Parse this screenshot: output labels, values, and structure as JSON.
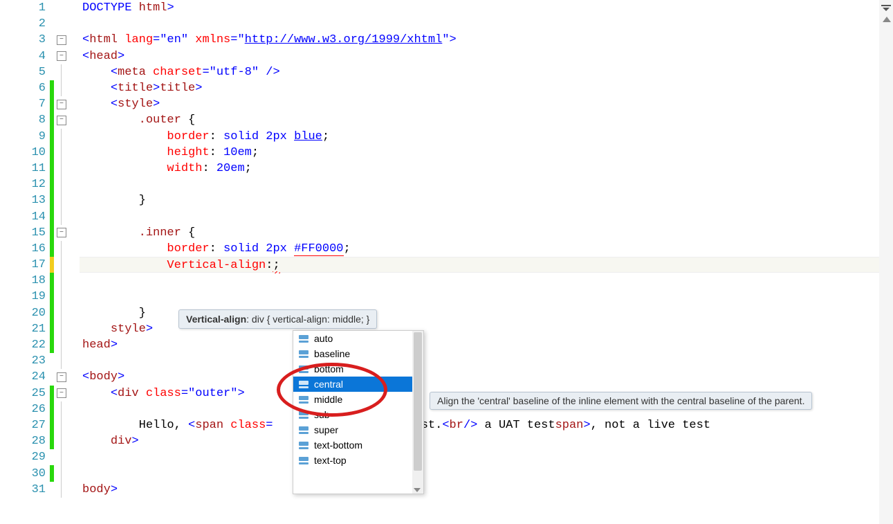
{
  "lines": [
    {
      "num": "1",
      "change": "",
      "fold": "none"
    },
    {
      "num": "2",
      "change": "",
      "fold": "none"
    },
    {
      "num": "3",
      "change": "",
      "fold": "minus"
    },
    {
      "num": "4",
      "change": "",
      "fold": "minus"
    },
    {
      "num": "5",
      "change": "",
      "fold": "line"
    },
    {
      "num": "6",
      "change": "green",
      "fold": "line"
    },
    {
      "num": "7",
      "change": "green",
      "fold": "minus"
    },
    {
      "num": "8",
      "change": "green",
      "fold": "minus"
    },
    {
      "num": "9",
      "change": "green",
      "fold": "line"
    },
    {
      "num": "10",
      "change": "green",
      "fold": "line"
    },
    {
      "num": "11",
      "change": "green",
      "fold": "line"
    },
    {
      "num": "12",
      "change": "green",
      "fold": "line"
    },
    {
      "num": "13",
      "change": "green",
      "fold": "line"
    },
    {
      "num": "14",
      "change": "green",
      "fold": "line"
    },
    {
      "num": "15",
      "change": "green",
      "fold": "minus"
    },
    {
      "num": "16",
      "change": "green",
      "fold": "line"
    },
    {
      "num": "17",
      "change": "yellow",
      "fold": "line"
    },
    {
      "num": "18",
      "change": "green",
      "fold": "line"
    },
    {
      "num": "19",
      "change": "green",
      "fold": "line"
    },
    {
      "num": "20",
      "change": "green",
      "fold": "line"
    },
    {
      "num": "21",
      "change": "green",
      "fold": "line"
    },
    {
      "num": "22",
      "change": "green",
      "fold": "line"
    },
    {
      "num": "23",
      "change": "",
      "fold": "line"
    },
    {
      "num": "24",
      "change": "",
      "fold": "minus"
    },
    {
      "num": "25",
      "change": "green",
      "fold": "minus"
    },
    {
      "num": "26",
      "change": "green",
      "fold": "line"
    },
    {
      "num": "27",
      "change": "green",
      "fold": "line"
    },
    {
      "num": "28",
      "change": "green",
      "fold": "line"
    },
    {
      "num": "29",
      "change": "",
      "fold": "line"
    },
    {
      "num": "30",
      "change": "green",
      "fold": "line"
    },
    {
      "num": "31",
      "change": "",
      "fold": "line"
    }
  ],
  "code": {
    "l1": {
      "open": "<!",
      "doctype": "DOCTYPE ",
      "html": "html",
      "close": ">"
    },
    "l3": {
      "open": "<",
      "tag": "html",
      "sp": " ",
      "attr1": "lang",
      "eq": "=",
      "val1": "\"en\"",
      "attr2": "xmlns",
      "val2url": "http://www.w3.org/1999/xhtml",
      "close": ">"
    },
    "l4": {
      "open": "<",
      "tag": "head",
      "close": ">"
    },
    "l5": {
      "open": "<",
      "tag": "meta",
      "sp": " ",
      "attr": "charset",
      "eq": "=",
      "val": "\"utf-8\"",
      "end": " />"
    },
    "l6": {
      "open": "<",
      "tag": "title",
      "close": ">",
      "open2": "</",
      "tag2": "title",
      "close2": ">"
    },
    "l7": {
      "open": "<",
      "tag": "style",
      "close": ">"
    },
    "l8": {
      "sel": ".outer ",
      "brace": "{"
    },
    "l9": {
      "prop": "border",
      "colon": ": ",
      "val": "solid 2px ",
      "blue": "blue",
      "semi": ";"
    },
    "l10": {
      "prop": "height",
      "colon": ": ",
      "val": "10em",
      "semi": ";"
    },
    "l11": {
      "prop": "width",
      "colon": ": ",
      "val": "20em",
      "semi": ";"
    },
    "l13": {
      "brace": "}"
    },
    "l15": {
      "sel": ".inner ",
      "brace": "{"
    },
    "l16": {
      "prop": "border",
      "colon": ": ",
      "val": "solid 2px ",
      "color": "#FF0000",
      "semi": ";"
    },
    "l17": {
      "prop": "Vertical-align",
      "colon": ":",
      "semi": ";"
    },
    "l20": {
      "brace": "}"
    },
    "l21": {
      "open": "</",
      "tag": "style",
      "close": ">"
    },
    "l22": {
      "open": "</",
      "tag": "head",
      "close": ">"
    },
    "l24": {
      "open": "<",
      "tag": "body",
      "close": ">"
    },
    "l25": {
      "open": "<",
      "tag": "div",
      "sp": " ",
      "attr": "class",
      "eq": "=",
      "val": "\"outer\"",
      "close": ">"
    },
    "l27": {
      "text1": "Hello, ",
      "open": "<",
      "tag": "span",
      "sp": " ",
      "attr": "class",
      "eq": "=",
      "text2": " test.",
      "open2": "<",
      "tag2": "br",
      "close2": "/>",
      "text3": " a UAT test",
      "open3": "</",
      "tag3": "span",
      "close3": ">",
      "text4": ", not a live test"
    },
    "l28": {
      "open": "</",
      "tag": "div",
      "close": ">"
    },
    "l31": {
      "open": "</",
      "tag": "body",
      "close": ">"
    }
  },
  "hint": {
    "label": "Vertical-align",
    "text": ": div { vertical-align: middle; }"
  },
  "autocomplete": {
    "items": [
      "auto",
      "baseline",
      "bottom",
      "central",
      "middle",
      "sub",
      "super",
      "text-bottom",
      "text-top"
    ],
    "selected": 3
  },
  "tooltip": "Align the 'central' baseline of the inline element with the central baseline of the parent."
}
